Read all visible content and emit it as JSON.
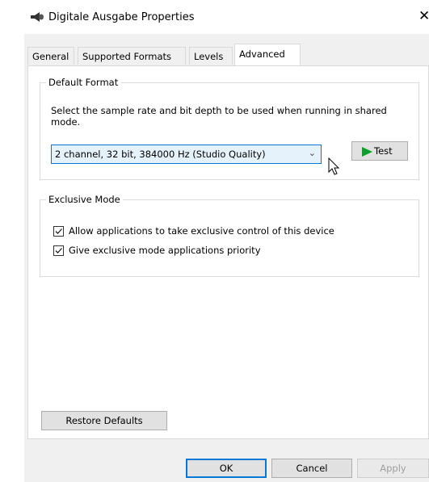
{
  "window": {
    "title": "Digitale Ausgabe Properties",
    "close_glyph": "✕",
    "icon": "speaker-icon"
  },
  "tabs": [
    {
      "label": "General",
      "active": false
    },
    {
      "label": "Supported Formats",
      "active": false
    },
    {
      "label": "Levels",
      "active": false
    },
    {
      "label": "Advanced",
      "active": true
    }
  ],
  "default_format": {
    "group_label": "Default Format",
    "description": "Select the sample rate and bit depth to be used when running in shared mode.",
    "selected_format": "2 channel, 32 bit, 384000 Hz (Studio Quality)",
    "dropdown_icon": "chevron-down-icon",
    "test_label": "Test",
    "test_icon": "play-icon",
    "play_color": "#119c2e"
  },
  "exclusive_mode": {
    "group_label": "Exclusive Mode",
    "options": [
      {
        "label": "Allow applications to take exclusive control of this device",
        "checked": true
      },
      {
        "label": "Give exclusive mode applications priority",
        "checked": true
      }
    ]
  },
  "restore_defaults_label": "Restore Defaults",
  "footer": {
    "ok_label": "OK",
    "cancel_label": "Cancel",
    "apply_label": "Apply",
    "apply_enabled": false
  },
  "colors": {
    "accent": "#0078d7",
    "dialog_bg": "#f0f0f0"
  }
}
